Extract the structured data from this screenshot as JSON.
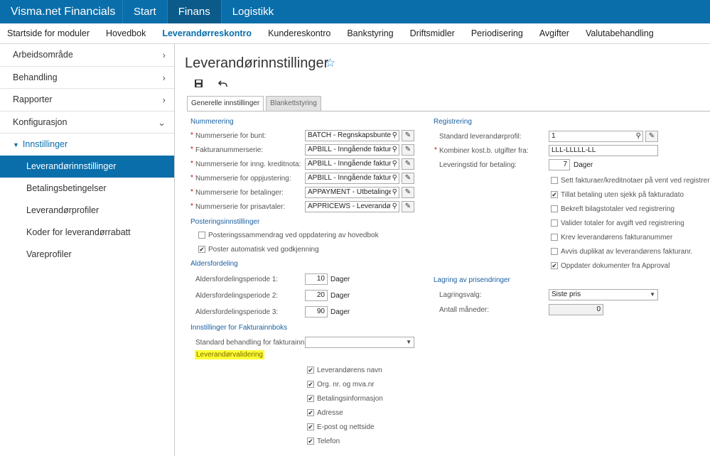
{
  "app": {
    "name": "Visma.net Financials"
  },
  "topnav": [
    {
      "label": "Start",
      "active": false
    },
    {
      "label": "Finans",
      "active": true
    },
    {
      "label": "Logistikk",
      "active": false
    }
  ],
  "subnav": [
    {
      "label": "Startside for moduler",
      "active": false
    },
    {
      "label": "Hovedbok",
      "active": false
    },
    {
      "label": "Leverandørreskontro",
      "active": true
    },
    {
      "label": "Kundereskontro",
      "active": false
    },
    {
      "label": "Bankstyring",
      "active": false
    },
    {
      "label": "Driftsmidler",
      "active": false
    },
    {
      "label": "Periodisering",
      "active": false
    },
    {
      "label": "Avgifter",
      "active": false
    },
    {
      "label": "Valutabehandling",
      "active": false
    }
  ],
  "sidebar": {
    "items": [
      {
        "label": "Arbeidsområde",
        "chevron": "›"
      },
      {
        "label": "Behandling",
        "chevron": "›"
      },
      {
        "label": "Rapporter",
        "chevron": "›"
      },
      {
        "label": "Konfigurasjon",
        "chevron": "⌄"
      }
    ],
    "group": {
      "label": "Innstillinger",
      "icon": "caret-down-icon"
    },
    "subitems": [
      {
        "label": "Leverandørinnstillinger",
        "active": true
      },
      {
        "label": "Betalingsbetingelser",
        "active": false
      },
      {
        "label": "Leverandørprofiler",
        "active": false
      },
      {
        "label": "Koder for leverandørrabatt",
        "active": false
      },
      {
        "label": "Vareprofiler",
        "active": false
      }
    ]
  },
  "page": {
    "title": "Leverandørinnstillinger",
    "star_icon": "star-icon",
    "toolbar": {
      "save_icon": "save-icon",
      "undo_icon": "undo-icon"
    },
    "tabs": [
      {
        "label": "Generelle innstillinger",
        "active": true
      },
      {
        "label": "Blankettstyring",
        "active": false
      }
    ]
  },
  "left": {
    "numbering": {
      "title": "Nummerering",
      "rows": [
        {
          "label": "Nummerserie for bunt:",
          "value": "BATCH - Regnskapsbunter"
        },
        {
          "label": "Fakturanummerserie:",
          "value": "APBILL - Inngående faktura"
        },
        {
          "label": "Nummerserie for inng. kreditnota:",
          "value": "APBILL - Inngående faktura"
        },
        {
          "label": "Nummerserie for oppjustering:",
          "value": "APBILL - Inngående faktura"
        },
        {
          "label": "Nummerserie for betalinger:",
          "value": "APPAYMENT - Utbetalinger"
        },
        {
          "label": "Nummerserie for prisavtaler:",
          "value": "APPRICEWS - Leverandørp"
        }
      ]
    },
    "posting": {
      "title": "Posteringsinnstillinger",
      "checks": [
        {
          "label": "Posteringssammendrag ved oppdatering av hovedbok",
          "checked": false
        },
        {
          "label": "Poster automatisk ved godkjenning",
          "checked": true
        }
      ]
    },
    "aging": {
      "title": "Aldersfordeling",
      "rows": [
        {
          "label": "Aldersfordelingsperiode 1:",
          "value": "10",
          "unit": "Dager"
        },
        {
          "label": "Aldersfordelingsperiode 2:",
          "value": "20",
          "unit": "Dager"
        },
        {
          "label": "Aldersfordelingsperiode 3:",
          "value": "90",
          "unit": "Dager"
        }
      ]
    },
    "invoice_inbox": {
      "title": "Innstillinger for Fakturainnboks",
      "std_label": "Standard behandling for fakturainn...",
      "std_value": "",
      "validation_label": "Leverandørvalidering",
      "checks": [
        {
          "label": "Leverandørens navn",
          "checked": true
        },
        {
          "label": "Org. nr. og mva.nr",
          "checked": true
        },
        {
          "label": "Betalingsinformasjon",
          "checked": true
        },
        {
          "label": "Adresse",
          "checked": true
        },
        {
          "label": "E-post og nettside",
          "checked": true
        },
        {
          "label": "Telefon",
          "checked": true
        }
      ]
    }
  },
  "right": {
    "registration": {
      "title": "Registrering",
      "profile_label": "Standard leverandørprofil:",
      "profile_value": "1",
      "combine_label": "Kombiner kost.b. utgifter fra:",
      "combine_value": "LLL-LLLLL-LL",
      "leadtime_label": "Leveringstid for betaling:",
      "leadtime_value": "7",
      "leadtime_unit": "Dager",
      "checks": [
        {
          "label": "Sett fakturaer/kreditnotaer på vent ved registrering",
          "checked": false
        },
        {
          "label": "Tillat betaling uten sjekk på fakturadato",
          "checked": true
        },
        {
          "label": "Bekreft bilagstotaler ved registrering",
          "checked": false
        },
        {
          "label": "Valider totaler for avgift ved registrering",
          "checked": false
        },
        {
          "label": "Krev leverandørens fakturanummer",
          "checked": false
        },
        {
          "label": "Avvis duplikat av leverandørens fakturanr.",
          "checked": false
        },
        {
          "label": "Oppdater dokumenter fra Approval",
          "checked": true
        }
      ]
    },
    "price_storage": {
      "title": "Lagring av prisendringer",
      "option_label": "Lagringsvalg:",
      "option_value": "Siste pris",
      "months_label": "Antall måneder:",
      "months_value": "0"
    }
  },
  "glyphs": {
    "check": "✔",
    "search": "⚲",
    "pencil": "✎",
    "dropdown": "▼"
  },
  "colors": {
    "topbar": "#0a6eaa",
    "active_item": "#0a6eaa",
    "section": "#1a5fa0",
    "highlight": "#ffff33"
  }
}
